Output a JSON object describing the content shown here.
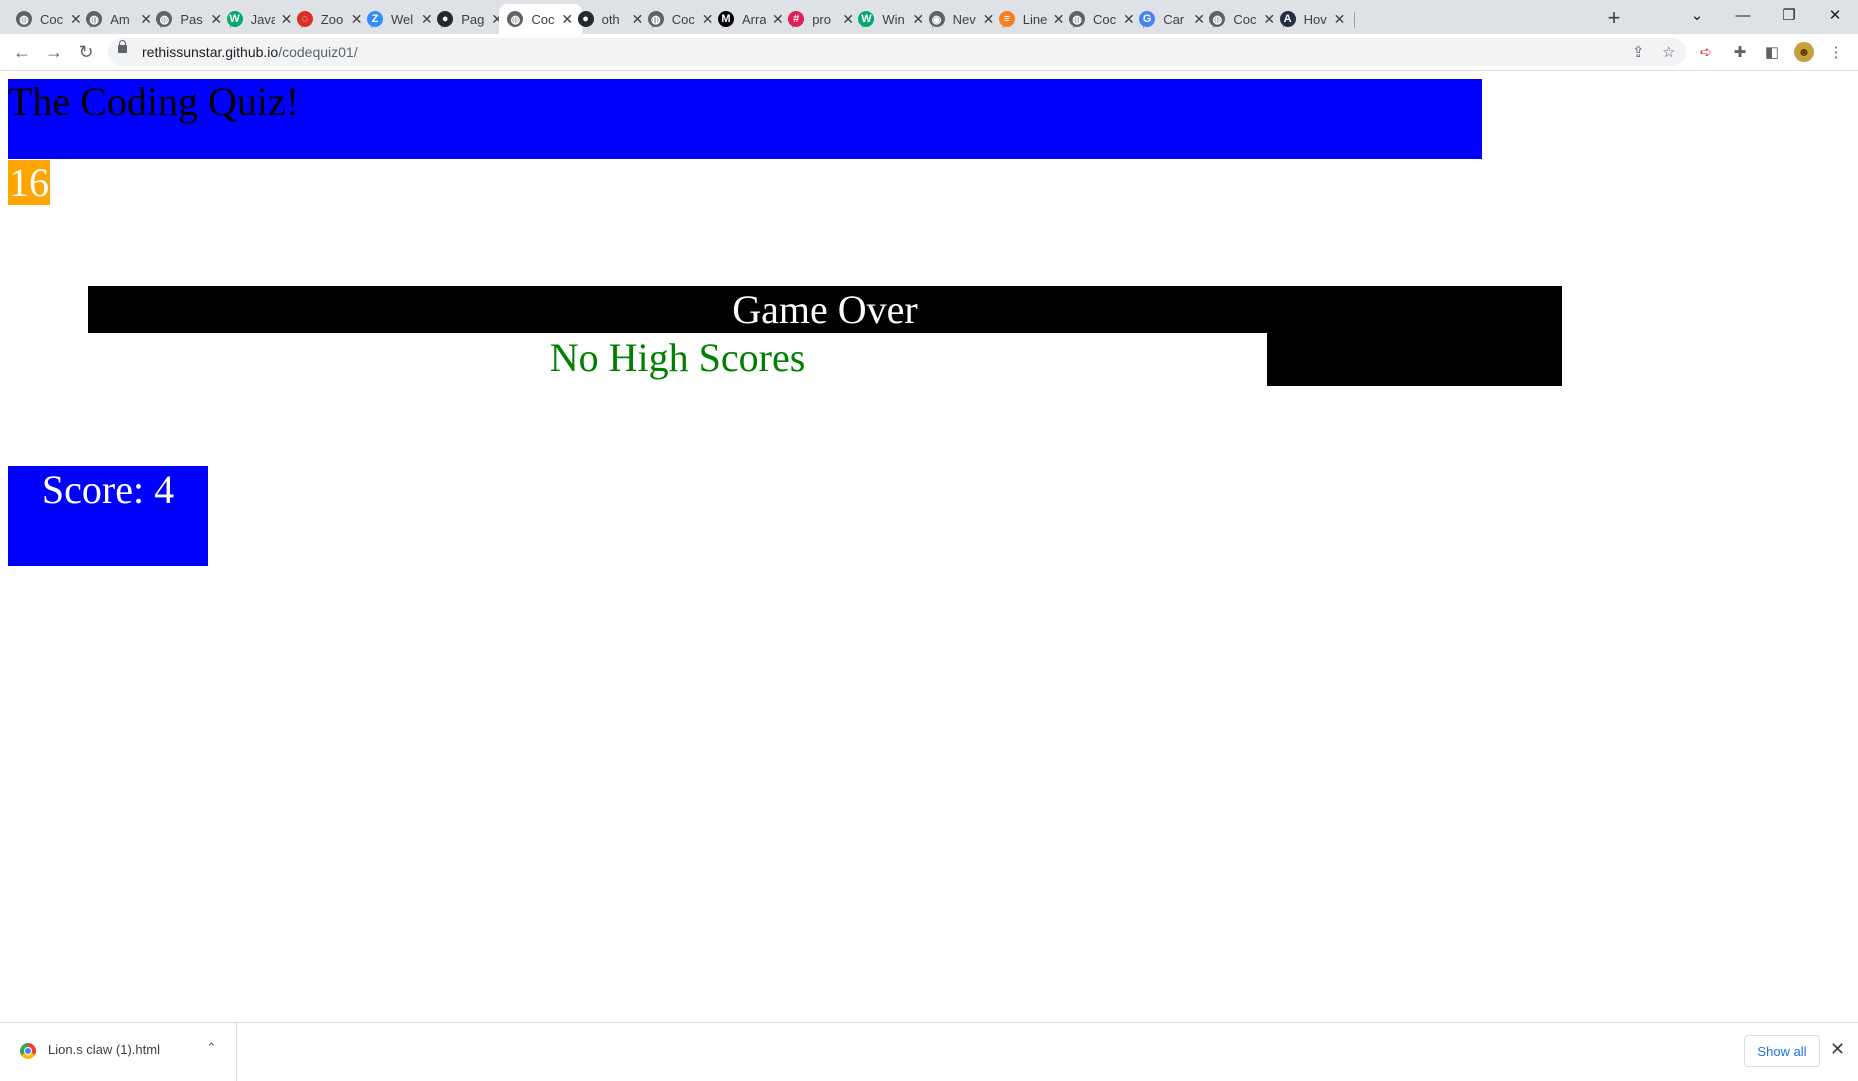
{
  "browser": {
    "tabs": [
      {
        "label": "Coc",
        "icon": "globe-icon",
        "color": "#5f6368"
      },
      {
        "label": "Am",
        "icon": "globe-icon",
        "color": "#5f6368"
      },
      {
        "label": "Pas",
        "icon": "globe-icon",
        "color": "#5f6368"
      },
      {
        "label": "Java",
        "icon": "w3schools-icon",
        "color": "#04aa6d"
      },
      {
        "label": "Zoo",
        "icon": "zoom-ring-icon",
        "color": "#d93025"
      },
      {
        "label": "Wel",
        "icon": "zoom-icon",
        "color": "#2d8cff"
      },
      {
        "label": "Pag",
        "icon": "github-icon",
        "color": "#24292f"
      },
      {
        "label": "Coc",
        "icon": "globe-icon",
        "color": "#5f6368"
      },
      {
        "label": "oth",
        "icon": "github-icon",
        "color": "#24292f"
      },
      {
        "label": "Coc",
        "icon": "globe-icon",
        "color": "#5f6368"
      },
      {
        "label": "Arra",
        "icon": "mdn-icon",
        "color": "#000000"
      },
      {
        "label": "pro",
        "icon": "slack-icon",
        "color": "#e01e5a"
      },
      {
        "label": "Win",
        "icon": "w3schools-icon",
        "color": "#04aa6d"
      },
      {
        "label": "Nev",
        "icon": "chrome-icon",
        "color": "#5f6368"
      },
      {
        "label": "Line",
        "icon": "stackoverflow-icon",
        "color": "#f48024"
      },
      {
        "label": "Coc",
        "icon": "globe-icon",
        "color": "#5f6368"
      },
      {
        "label": "Car",
        "icon": "google-icon",
        "color": "#4285f4"
      },
      {
        "label": "Coc",
        "icon": "globe-icon",
        "color": "#5f6368"
      },
      {
        "label": "Hov",
        "icon": "aws-icon",
        "color": "#232f3e"
      }
    ],
    "active_tab_index": 7,
    "url_host": "rethissunstar.github.io",
    "url_path": "/codequiz01/"
  },
  "page": {
    "title": "The Coding Quiz!",
    "timer": "16",
    "game_over": "Game Over",
    "high_scores": "No High Scores",
    "score": "Score: 4"
  },
  "downloads": {
    "file_name": "Lion.s claw (1).html",
    "show_all": "Show all"
  },
  "colors": {
    "banner": "#0000ff",
    "timer": "#ffa500",
    "high_scores_text": "#008000",
    "game_over_bar": "#000000"
  }
}
